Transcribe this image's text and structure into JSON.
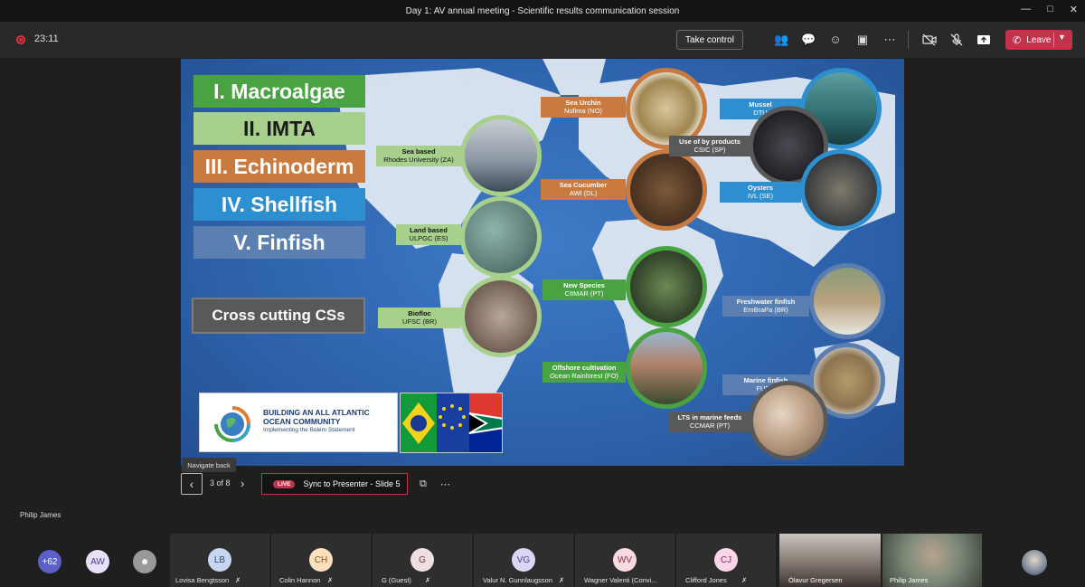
{
  "window": {
    "title": "Day 1: AV annual meeting - Scientific results communication session",
    "controls": [
      "minimize",
      "maximize",
      "close"
    ]
  },
  "toolbar": {
    "timer": "23:11",
    "take_control": "Take control",
    "leave_label": "Leave",
    "icons": [
      "people-icon",
      "chat-icon",
      "reactions-icon",
      "rooms-icon",
      "more-icon",
      "camera-off-icon",
      "mic-off-icon",
      "share-icon"
    ]
  },
  "slide": {
    "categories": [
      {
        "label": "I. Macroalgae",
        "color": "#4aa342"
      },
      {
        "label": "II. IMTA",
        "color": "#a8d08d"
      },
      {
        "label": "III. Echinoderm",
        "color": "#c97a3f"
      },
      {
        "label": "IV. Shellfish",
        "color": "#2e8fd0"
      },
      {
        "label": "V. Finfish",
        "color": "#5b7fb0"
      }
    ],
    "cross_cutting": "Cross cutting CSs",
    "studies": {
      "sea_based": {
        "title": "Sea based",
        "org": "Rhodes University (ZA)"
      },
      "land_based": {
        "title": "Land based",
        "org": "ULPGC (ES)"
      },
      "biofloc": {
        "title": "Biofloc",
        "org": "UFSC (BR)"
      },
      "sea_urchin": {
        "title": "Sea Urchin",
        "org": "Nofima (NO)"
      },
      "sea_cucumber": {
        "title": "Sea Cucumber",
        "org": "AWI (DL)"
      },
      "new_species": {
        "title": "New Species",
        "org": "CIIMAR (PT)"
      },
      "offshore": {
        "title": "Offshore cultivation",
        "org": "Ocean Rainforest (FO)"
      },
      "mussel": {
        "title": "Mussel",
        "org": "DTU"
      },
      "by_products": {
        "title": "Use of by products",
        "org": "CSIC (SP)"
      },
      "oysters": {
        "title": "Oysters",
        "org": "IVL (SE)"
      },
      "freshwater": {
        "title": "Freshwater finfish",
        "org": "EmBraPa (BR)"
      },
      "marine": {
        "title": "Marine finfish",
        "org": "FURG"
      },
      "lts": {
        "title": "LTS in marine feeds",
        "org": "CCMAR (PT)"
      }
    },
    "logo": {
      "line1": "BUILDING AN ALL ATLANTIC",
      "line2": "OCEAN COMMUNITY",
      "line3": "Implementing the Belém Statement"
    }
  },
  "navigation": {
    "back_tooltip": "Navigate back",
    "page_indicator": "3 of 8",
    "live_badge": "LIVE",
    "sync_label": "Sync to Presenter - Slide 5"
  },
  "presenter_name": "Philip James",
  "participants": {
    "overflow_count": "+62",
    "small_avatars": [
      {
        "initials": "AW"
      }
    ],
    "tiles": [
      {
        "initials": "LB",
        "name": "Lovisa Bengtsson",
        "avatar_color": "#c7d7f2",
        "text_color": "#2c4a82"
      },
      {
        "initials": "CH",
        "name": "Colin Hannon",
        "avatar_color": "#fde1bf",
        "text_color": "#8a5412"
      },
      {
        "initials": "G",
        "name": "G (Guest)",
        "avatar_color": "#f0dfe0",
        "text_color": "#6a3940"
      },
      {
        "initials": "VG",
        "name": "Valur N. Gunnlaugsson",
        "avatar_color": "#dad6f3",
        "text_color": "#4a3f8c"
      },
      {
        "initials": "WV",
        "name": "Wagner Valenti (Convi...",
        "avatar_color": "#f7dbe0",
        "text_color": "#8c2f44"
      },
      {
        "initials": "CJ",
        "name": "Clifford Jones",
        "avatar_color": "#fbd5e8",
        "text_color": "#8a2561"
      }
    ],
    "video_tiles": [
      {
        "name": "Ólavur Gregersen"
      },
      {
        "name": "Philip James"
      }
    ]
  }
}
